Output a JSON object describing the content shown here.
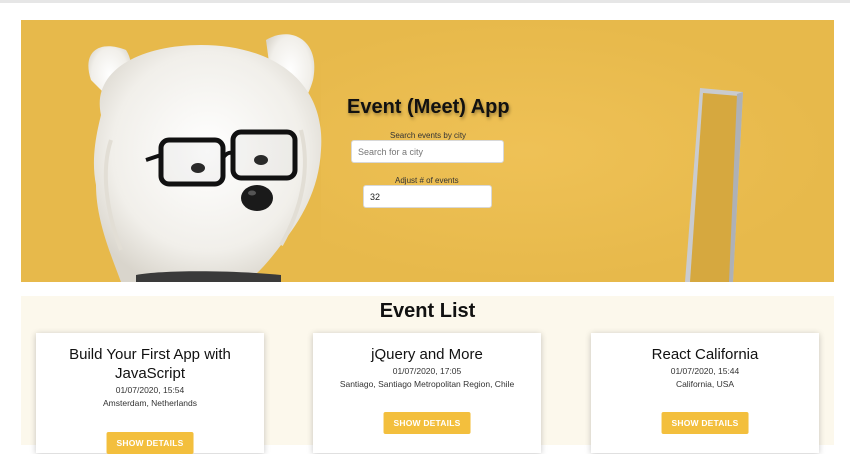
{
  "header": {
    "title": "Event (Meet) App"
  },
  "search": {
    "label": "Search events by city",
    "placeholder": "Search for a city",
    "value": ""
  },
  "count": {
    "label": "Adjust # of events",
    "value": "32"
  },
  "event_list": {
    "title": "Event List",
    "events": [
      {
        "name": "Build Your First App with JavaScript",
        "datetime": "01/07/2020, 15:54",
        "location": "Amsterdam, Netherlands",
        "button": "SHOW DETAILS"
      },
      {
        "name": "jQuery and More",
        "datetime": "01/07/2020, 17:05",
        "location": "Santiago, Santiago Metropolitan Region, Chile",
        "button": "SHOW DETAILS"
      },
      {
        "name": "React California",
        "datetime": "01/07/2020, 15:44",
        "location": "California, USA",
        "button": "SHOW DETAILS"
      }
    ]
  },
  "colors": {
    "hero_background": "#e7b94b",
    "button": "#f3bf3d",
    "list_background": "#fcf8ec"
  }
}
